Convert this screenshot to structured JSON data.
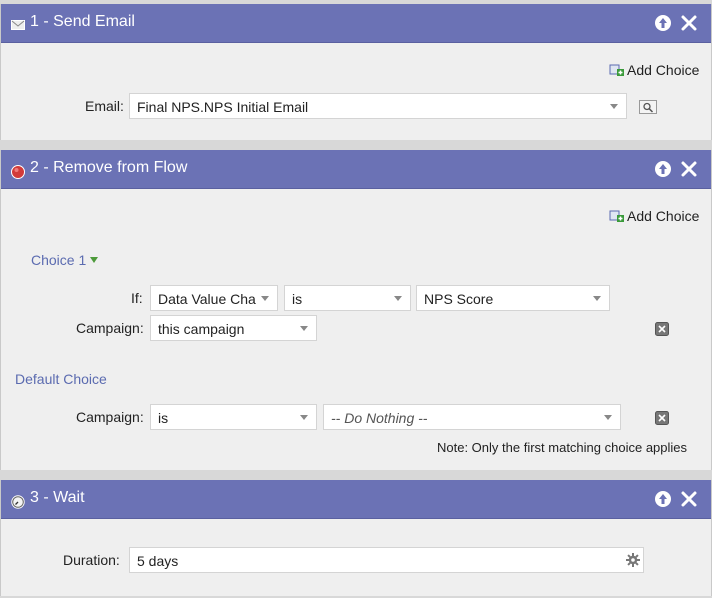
{
  "steps": [
    {
      "title": "1 - Send Email",
      "add_choice_label": "Add Choice",
      "email_label": "Email:",
      "email_value": "Final NPS.NPS Initial Email"
    },
    {
      "title": "2 - Remove from Flow",
      "add_choice_label": "Add Choice",
      "choice1_label": "Choice 1",
      "if_label": "If:",
      "if_field": "Data Value Cha",
      "if_operator": "is",
      "if_value": "NPS Score",
      "campaign_label": "Campaign:",
      "campaign_value": "this campaign",
      "default_choice_label": "Default Choice",
      "default_campaign_label": "Campaign:",
      "default_campaign_value": "is",
      "default_action": "-- Do Nothing --",
      "note": "Note: Only the first matching choice applies"
    },
    {
      "title": "3 - Wait",
      "duration_label": "Duration:",
      "duration_value": "5 days"
    }
  ],
  "icons": {
    "header_up": "arrow-up-icon",
    "header_close": "close-icon",
    "email_step": "email-icon",
    "remove_step": "stop-icon",
    "wait_step": "clock-icon",
    "add_choice": "add-choice-icon",
    "preview": "preview-icon",
    "delete_choice": "delete-icon",
    "gear": "gear-icon"
  },
  "colors": {
    "header": "#6b72b5",
    "panel": "#efefef",
    "link": "#5b6bb0"
  }
}
